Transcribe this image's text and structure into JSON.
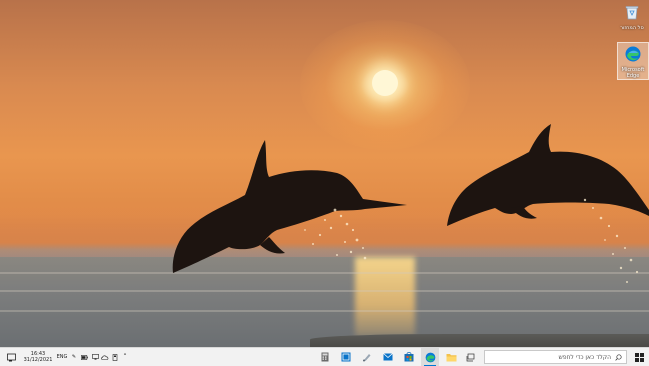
{
  "desktop": {
    "icons": [
      {
        "name": "recycle-bin",
        "label": "סל המחזור"
      },
      {
        "name": "microsoft-edge",
        "label": "Microsoft Edge"
      }
    ]
  },
  "taskbar": {
    "search": {
      "placeholder": "הקלד כאן כדי לחפש"
    },
    "pinned_apps": [
      "task-view",
      "edge",
      "file-explorer",
      "store",
      "mail",
      "photos",
      "calculator",
      "settings"
    ],
    "tray": {
      "language": "ENG",
      "time": "16:43",
      "date": "31/12/2021"
    }
  },
  "colors": {
    "accent": "#0078d4",
    "taskbar_bg": "#f2f2f2"
  }
}
